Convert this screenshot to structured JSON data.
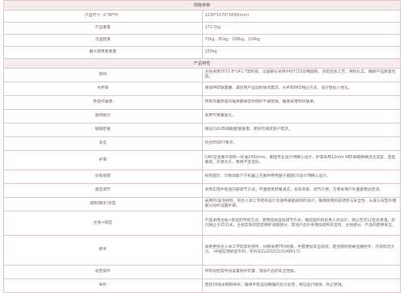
{
  "spec": {
    "title": "规格参数",
    "rows": [
      {
        "label": "产品尺寸（L*W*H）",
        "value": "1230*1570*1490(mm)"
      },
      {
        "label": "产品重量",
        "value": "171.5kg"
      },
      {
        "label": "可选配重",
        "value": "72kg、81kg、108kg、134kg"
      },
      {
        "label": "最大使用者重量",
        "value": "150kg"
      }
    ]
  },
  "features": {
    "title": "产品特性",
    "rows": [
      {
        "label": "管材",
        "value": "主柱采用Y072.8*141.7异形管，功能部分采用X40*133双椭圆管，双铝合金工艺，用料扎实，确保产品质量优势。"
      },
      {
        "label": "水杯架",
        "value": "增加PAD放置槽，满足用户运动时休闲需求，水杯和PAD独立方式，设计更加人性化。"
      },
      {
        "label": "移值作轴承",
        "value": "所有外露移值作轴承都被密封保护不被锈蚀，轴承采用NSK轴承。"
      },
      {
        "label": "座椅助力",
        "value": "采用气弹簧复位。"
      },
      {
        "label": "辅助配重",
        "value": "增加为XLBS辅助配重重量。更好的满足客户需求。"
      },
      {
        "label": "安全",
        "value": "符合EN957要求。"
      },
      {
        "label": "护罩",
        "value": "CAO全金属外观统一标准1492mm，美国专业设计师精心设计，护罩采用12mm ABS单模精细浇注成型，造型美观，外观大方，教用不变变形。"
      },
      {
        "label": "训练指南",
        "value": "标有图示、示数动能卡于机器上方部并便用国于美国US设计师精心设计。"
      },
      {
        "label": "座垫调节",
        "value": "采用实铝件管道内部调节方式，平面感觉舒服调试，安装简单、调节方便，方便采用户外面部更加灵活。"
      },
      {
        "label": "座制/脚步/背垫",
        "value": "采用PU发泡材料，符合人体工学结构设计及使用基础规则的设计，确保使用的舒适性与安全性，头靠与背垫外端部分动作设置护罩。"
      },
      {
        "label": "主视+帮挂",
        "value": "产品采用主视+帮挂的传统方式，使用固体自动调节方式，确定国内的优秀人员设计，销以至无12变处承组，剪力独立于25方式，主视实际的固定保护设施部分，其他产品外壳增加结构安全性，主视部分，产品的使用安全。"
      },
      {
        "label": "把手",
        "value": "采用更符合人体工学的异形把手，材质采用TPU材质，手握更加安全舒适，配合两侧效果显著把手，外观简洁大方。（中国实用新型专利，专利号ZL201521014891.5）"
      },
      {
        "label": "动密帮件",
        "value": "所有动密帮件加设置防护装置，增加产品的安全性能。"
      },
      {
        "label": "导杆",
        "value": "直径18毫米钢制导杆，确保平稳运动精确的张力反馈，保证运行顺滑，防止锈蚀。"
      }
    ]
  }
}
